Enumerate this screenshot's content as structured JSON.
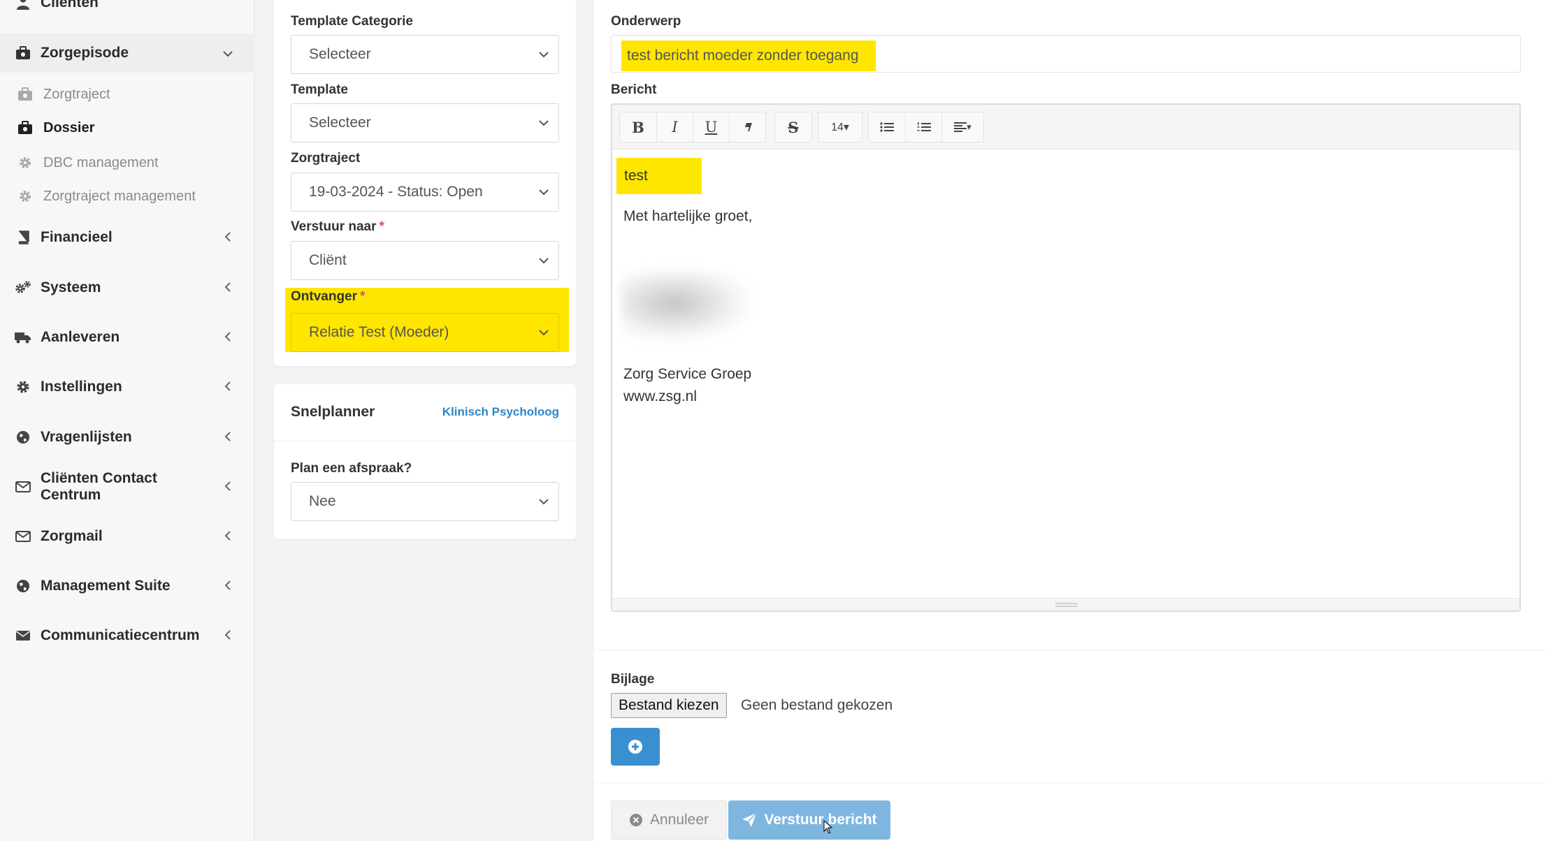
{
  "sidebar": {
    "clients_label": "Cliënten",
    "care_episode": {
      "label": "Zorgepisode",
      "chevron": "chevron-down-icon"
    },
    "subitems": [
      {
        "label": "Zorgtraject",
        "icon": "briefcase-icon"
      },
      {
        "label": "Dossier",
        "icon": "briefcase-icon"
      },
      {
        "label": "DBC management",
        "icon": "gear-icon"
      },
      {
        "label": "Zorgtraject management",
        "icon": "gear-icon"
      }
    ],
    "sections": [
      {
        "label": "Financieel",
        "icon": "book-icon"
      },
      {
        "label": "Systeem",
        "icon": "gears-icon"
      },
      {
        "label": "Aanleveren",
        "icon": "truck-icon"
      },
      {
        "label": "Instellingen",
        "icon": "gear-icon"
      },
      {
        "label": "Vragenlijsten",
        "icon": "globe-icon"
      },
      {
        "label": "Cliënten Contact Centrum",
        "icon": "envelope-icon"
      },
      {
        "label": "Zorgmail",
        "icon": "envelope-icon"
      },
      {
        "label": "Management Suite",
        "icon": "globe-icon"
      },
      {
        "label": "Communicatiecentrum",
        "icon": "envelope-solid-icon"
      }
    ]
  },
  "form": {
    "template_category": {
      "label": "Template Categorie",
      "value": "Selecteer"
    },
    "template": {
      "label": "Template",
      "value": "Selecteer"
    },
    "care_trajectory": {
      "label": "Zorgtraject",
      "value": "19-03-2024 - Status: Open"
    },
    "send_to": {
      "label": "Verstuur naar",
      "required_mark": "*",
      "value": "Cliënt"
    },
    "recipient": {
      "label": "Ontvanger",
      "required_mark": "*",
      "value": "Relatie Test (Moeder)"
    }
  },
  "planner": {
    "title": "Snelplanner",
    "link": "Klinisch Psycholoog",
    "question_label": "Plan een afspraak?",
    "question_value": "Nee"
  },
  "message": {
    "subject_label": "Onderwerp",
    "subject_value": "test bericht moeder zonder toegang",
    "body_label": "Bericht",
    "toolbar": {
      "bold": "B",
      "italic": "I",
      "underline": "U",
      "strike": "S",
      "font_size": "14▾",
      "align": "▾"
    },
    "body": {
      "first_line": "test",
      "greeting": "Met hartelijke groet,",
      "company": "Zorg Service Groep",
      "website": "www.zsg.nl"
    }
  },
  "attachment": {
    "label": "Bijlage",
    "choose_button": "Bestand kiezen",
    "status": "Geen bestand gekozen"
  },
  "actions": {
    "cancel": "Annuleer",
    "send": "Verstuur bericht"
  },
  "colors": {
    "highlight": "#ffe600",
    "primary": "#3a8fd0",
    "link": "#2a86c8"
  }
}
